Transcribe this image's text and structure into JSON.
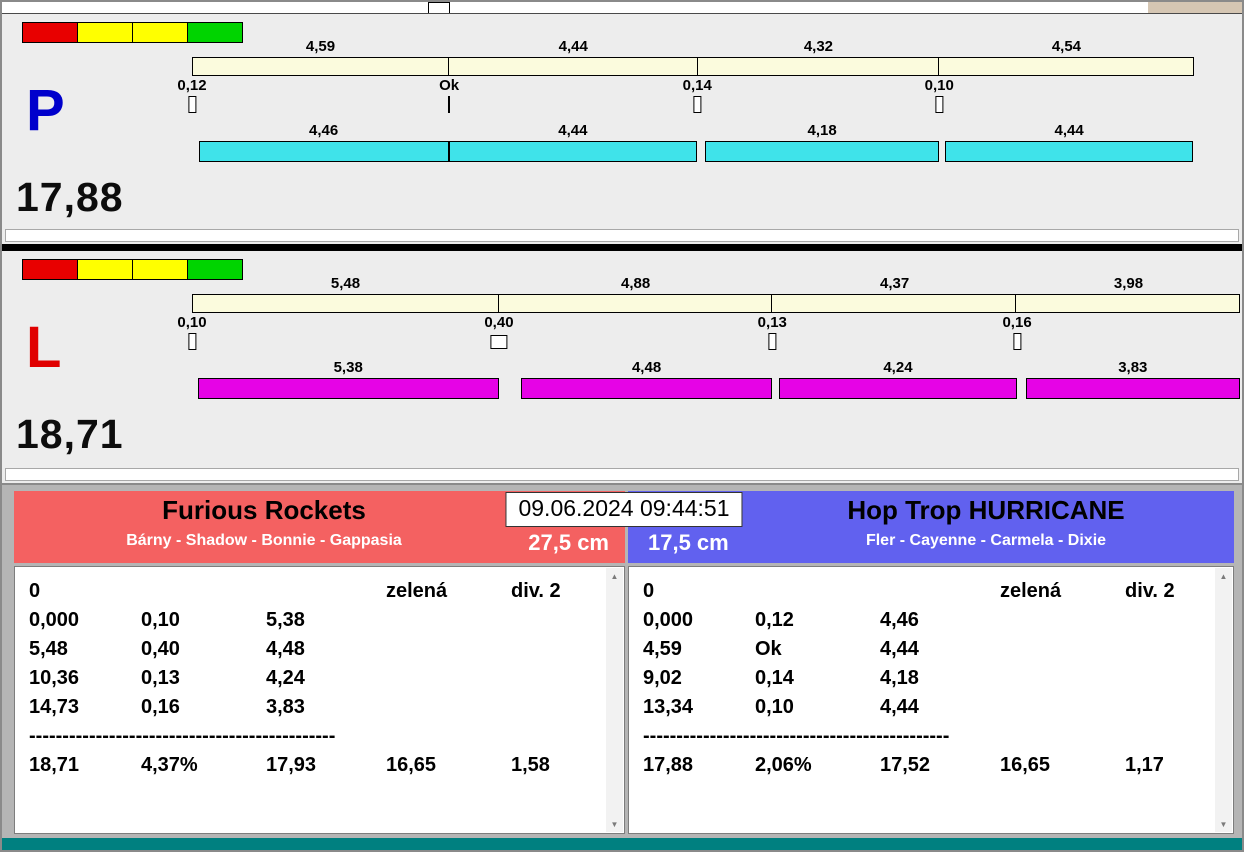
{
  "traffic": {
    "colors": [
      "#e80000",
      "#ffff00",
      "#ffff00",
      "#00d400"
    ]
  },
  "lanes": [
    {
      "letter": "P",
      "letter_color": "#0000cc",
      "bar_color": "#3fe3ea",
      "total_label": "17,88",
      "total_value": 17.88,
      "sections": [
        {
          "label": "4,59",
          "value": 4.59
        },
        {
          "label": "4,44",
          "value": 4.44
        },
        {
          "label": "4,32",
          "value": 4.32
        },
        {
          "label": "4,54",
          "value": 4.54
        }
      ],
      "changes": [
        {
          "label": "0,12",
          "at": 0,
          "value": 0.12,
          "marker": "box-thin"
        },
        {
          "label": "Ok",
          "at": 4.59,
          "value": 0,
          "marker": "line"
        },
        {
          "label": "0,14",
          "at": 9.02,
          "value": 0.14,
          "marker": "box-thin"
        },
        {
          "label": "0,10",
          "at": 13.34,
          "value": 0.1,
          "marker": "box-thin"
        }
      ],
      "dogs": [
        {
          "label": "4,46",
          "value": 4.46
        },
        {
          "label": "4,44",
          "value": 4.44
        },
        {
          "label": "4,18",
          "value": 4.18
        },
        {
          "label": "4,44",
          "value": 4.44
        }
      ]
    },
    {
      "letter": "L",
      "letter_color": "#e00000",
      "bar_color": "#e603e6",
      "total_label": "18,71",
      "total_value": 18.71,
      "sections": [
        {
          "label": "5,48",
          "value": 5.48
        },
        {
          "label": "4,88",
          "value": 4.88
        },
        {
          "label": "4,37",
          "value": 4.37
        },
        {
          "label": "3,98",
          "value": 3.98
        }
      ],
      "changes": [
        {
          "label": "0,10",
          "at": 0,
          "value": 0.1,
          "marker": "box-thin"
        },
        {
          "label": "0,40",
          "at": 5.48,
          "value": 0.4,
          "marker": "box-wide"
        },
        {
          "label": "0,13",
          "at": 10.36,
          "value": 0.13,
          "marker": "box-thin"
        },
        {
          "label": "0,16",
          "at": 14.73,
          "value": 0.16,
          "marker": "box-thin"
        }
      ],
      "dogs": [
        {
          "label": "5,38",
          "value": 5.38
        },
        {
          "label": "4,48",
          "value": 4.48
        },
        {
          "label": "4,24",
          "value": 4.24
        },
        {
          "label": "3,83",
          "value": 3.83
        }
      ]
    }
  ],
  "scoreboard": {
    "timestamp": "09.06.2024 09:44:51",
    "left": {
      "team": "Furious Rockets",
      "dogs": "Bárny - Shadow - Bonnie - Gappasia",
      "height": "27,5 cm",
      "header_color": "#f46161",
      "table": {
        "first_col": "0",
        "category": "zelená",
        "division": "div. 2",
        "rows": [
          [
            "0,000",
            "0,10",
            "5,38"
          ],
          [
            "5,48",
            "0,40",
            "4,48"
          ],
          [
            "10,36",
            "0,13",
            "4,24"
          ],
          [
            "14,73",
            "0,16",
            "3,83"
          ]
        ],
        "separator": "----------------------------------------------",
        "summary": [
          "18,71",
          "4,37%",
          "17,93",
          "16,65",
          "1,58"
        ]
      }
    },
    "right": {
      "team": "Hop Trop HURRICANE",
      "dogs": "Fler - Cayenne - Carmela - Dixie",
      "height": "17,5 cm",
      "header_color": "#6161ef",
      "table": {
        "first_col": "0",
        "category": "zelená",
        "division": "div. 2",
        "rows": [
          [
            "0,000",
            "0,12",
            "4,46"
          ],
          [
            "4,59",
            "Ok",
            "4,44"
          ],
          [
            "9,02",
            "0,14",
            "4,18"
          ],
          [
            "13,34",
            "0,10",
            "4,44"
          ]
        ],
        "separator": "----------------------------------------------",
        "summary": [
          "17,88",
          "2,06%",
          "17,52",
          "16,65",
          "1,17"
        ]
      }
    }
  }
}
